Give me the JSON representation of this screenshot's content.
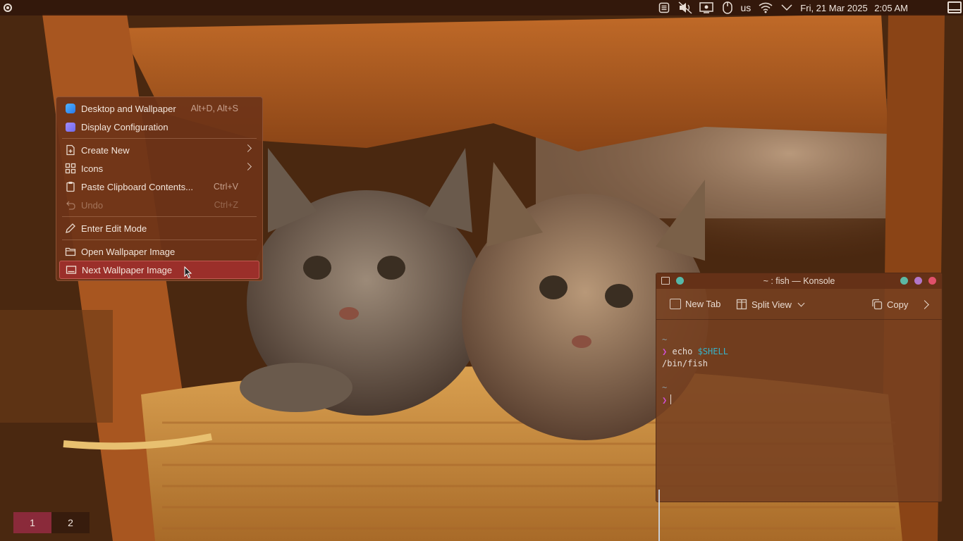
{
  "top_panel": {
    "keyboard_layout": "us",
    "date": "Fri, 21 Mar 2025",
    "time": "2:05 AM",
    "tray_icons": [
      "notes-icon",
      "volume-muted-icon",
      "display-icon",
      "mouse-battery-icon",
      "keyboard-layout",
      "wifi-icon",
      "chevron-down-icon"
    ]
  },
  "context_menu": {
    "items": [
      {
        "label": "Desktop and Wallpaper",
        "shortcut": "Alt+D, Alt+S",
        "icon": "desktop-wallpaper-icon"
      },
      {
        "label": "Display Configuration",
        "icon": "display-configuration-icon"
      },
      {
        "label": "Create New",
        "icon": "create-new-icon",
        "submenu": true
      },
      {
        "label": "Icons",
        "icon": "grid-icon",
        "submenu": true
      },
      {
        "label": "Paste Clipboard Contents...",
        "shortcut": "Ctrl+V",
        "icon": "clipboard-icon"
      },
      {
        "label": "Undo",
        "shortcut": "Ctrl+Z",
        "icon": "undo-icon",
        "disabled": true
      },
      {
        "label": "Enter Edit Mode",
        "icon": "pencil-icon"
      },
      {
        "label": "Open Wallpaper Image",
        "icon": "folder-icon"
      },
      {
        "label": "Next Wallpaper Image",
        "icon": "image-icon",
        "highlighted": true
      }
    ]
  },
  "konsole": {
    "title": "~ : fish — Konsole",
    "toolbar": {
      "new_tab": "New Tab",
      "split_view": "Split View",
      "copy": "Copy"
    },
    "terminal": {
      "line1_dir": "~",
      "line2_prompt": "❯",
      "line2_cmd": "echo",
      "line2_var": "$SHELL",
      "line3_output": "/bin/fish",
      "line4_dir": "~",
      "line5_prompt": "❯"
    }
  },
  "pager": {
    "desktops": [
      "1",
      "2"
    ],
    "active": "1"
  },
  "colors": {
    "menu_highlight": "#9b2f2a",
    "prompt": "#cf4fd1",
    "variable": "#36b3c9",
    "active_desktop": "#8a2a3a"
  }
}
